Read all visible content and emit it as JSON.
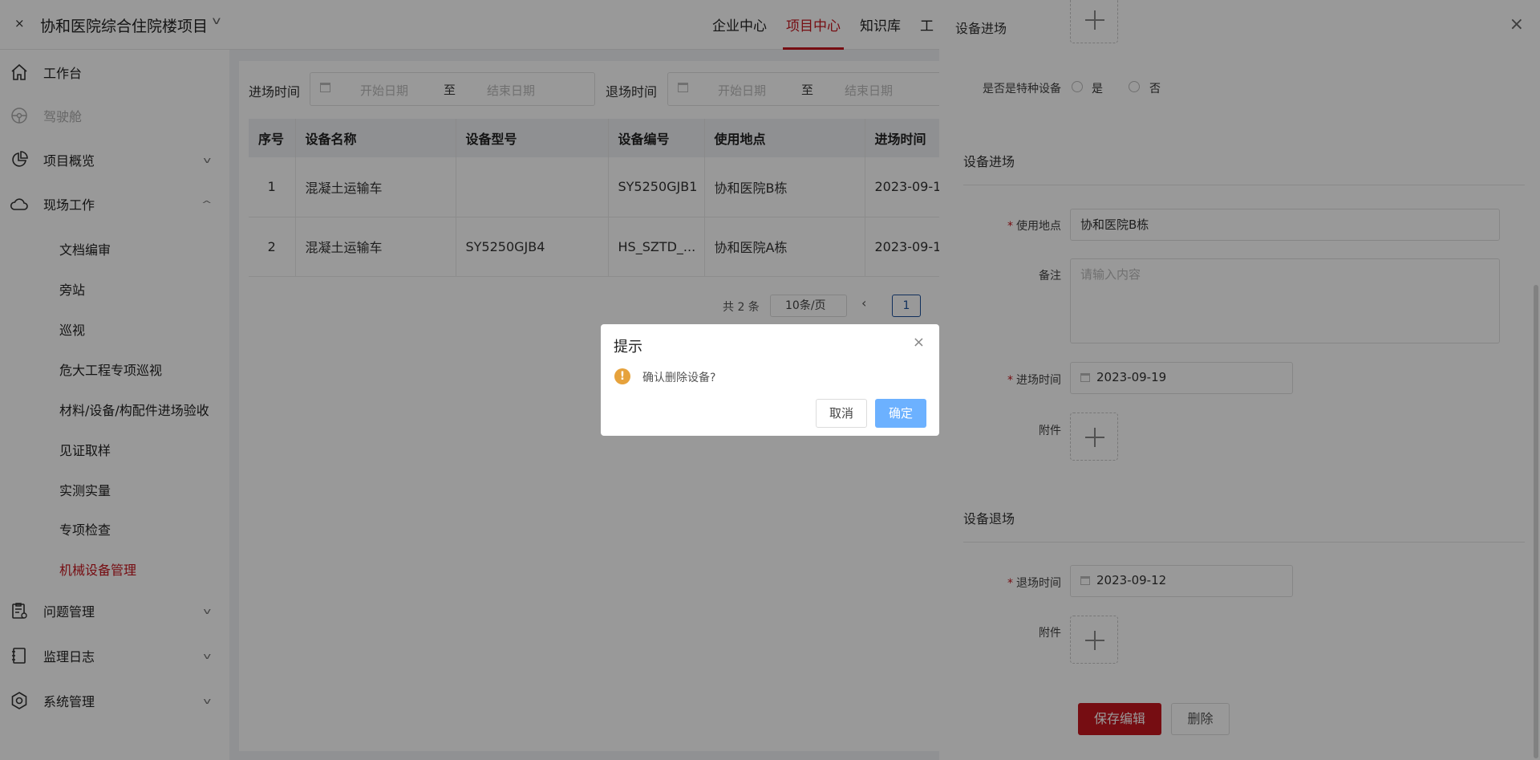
{
  "header": {
    "close_glyph": "×",
    "project_name": "协和医院综合住院楼项目",
    "nav": [
      "企业中心",
      "项目中心",
      "知识库",
      "工"
    ]
  },
  "sidebar": {
    "items": [
      {
        "label": "工作台",
        "icon": "home-icon"
      },
      {
        "label": "驾驶舱",
        "icon": "steering-wheel-icon"
      },
      {
        "label": "项目概览",
        "icon": "pie-chart-icon"
      },
      {
        "label": "现场工作",
        "icon": "cloud-icon"
      },
      {
        "label": "问题管理",
        "icon": "clipboard-icon"
      },
      {
        "label": "监理日志",
        "icon": "notebook-icon"
      },
      {
        "label": "系统管理",
        "icon": "settings-icon"
      }
    ],
    "subitems": [
      "文档编审",
      "旁站",
      "巡视",
      "危大工程专项巡视",
      "材料/设备/构配件进场验收",
      "见证取样",
      "实测实量",
      "专项检查",
      "机械设备管理"
    ]
  },
  "filters": {
    "entry_label": "进场时间",
    "exit_label": "退场时间",
    "start_placeholder": "开始日期",
    "end_placeholder": "结束日期",
    "range_sep": "至"
  },
  "table": {
    "headers": [
      "序号",
      "设备名称",
      "设备型号",
      "设备编号",
      "使用地点",
      "进场时间"
    ],
    "rows": [
      [
        "1",
        "混凝土运输车",
        "",
        "SY5250GJB1",
        "协和医院B栋",
        "2023-09-1"
      ],
      [
        "2",
        "混凝土运输车",
        "SY5250GJB4",
        "HS_SZTD_...",
        "协和医院A栋",
        "2023-09-1"
      ]
    ]
  },
  "pagination": {
    "total_text": "共 2 条",
    "page_size": "10条/页",
    "prev": "‹",
    "current": "1"
  },
  "drawer": {
    "title": "设备进场",
    "special_label": "是否是特种设备",
    "yes": "是",
    "no": "否",
    "section_entry": "设备进场",
    "location_label": "使用地点",
    "location_value": "协和医院B栋",
    "remark_label": "备注",
    "remark_placeholder": "请输入内容",
    "entry_time_label": "进场时间",
    "entry_time_value": "2023-09-19",
    "attachment_label": "附件",
    "section_exit": "设备退场",
    "exit_time_label": "退场时间",
    "exit_time_value": "2023-09-12",
    "save_button": "保存编辑",
    "delete_button": "删除",
    "required_mark": "*"
  },
  "dialog": {
    "title": "提示",
    "message": "确认删除设备?",
    "cancel": "取消",
    "ok": "确定",
    "warn_glyph": "!"
  },
  "colors": {
    "brand_red": "#c5171f",
    "primary_blue": "#6cb1ff",
    "warning": "#e6a23c"
  }
}
